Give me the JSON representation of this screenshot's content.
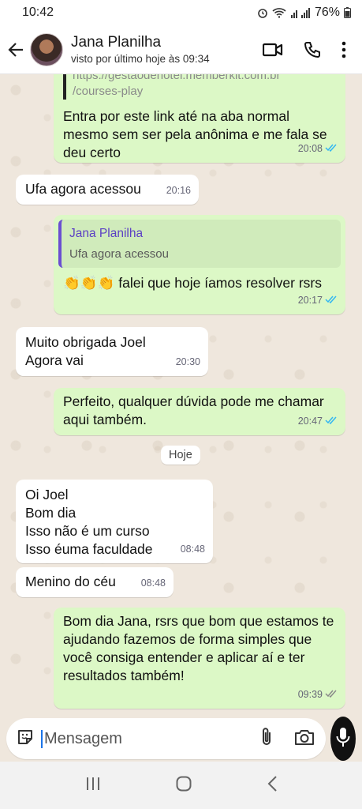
{
  "status_bar": {
    "time": "10:42",
    "battery": "76%"
  },
  "header": {
    "contact_name": "Jana Planilha",
    "contact_status": "visto por último hoje às 09:34"
  },
  "messages": [
    {
      "link_text": "https://gestaodehotel.memberkit.com.br\n/courses-play",
      "text": "Entra por este link até na aba normal mesmo sem ser pela anônima e me fala se deu certo",
      "time": "20:08"
    },
    {
      "text": "Ufa agora acessou",
      "time": "20:16"
    },
    {
      "quote_name": "Jana Planilha",
      "quote_text": "Ufa agora acessou",
      "text": "👏👏👏 falei que hoje íamos resolver rsrs",
      "time": "20:17"
    },
    {
      "text": "Muito obrigada Joel\nAgora vai",
      "time": "20:30"
    },
    {
      "text": "Perfeito, qualquer dúvida pode me chamar aqui também.",
      "time": "20:47"
    },
    {
      "text": "Oi Joel\nBom dia\nIsso não é um curso\nIsso éuma faculdade",
      "time": "08:48"
    },
    {
      "text": "Menino do céu",
      "time": "08:48"
    },
    {
      "text": "Bom dia Jana, rsrs que bom que estamos te ajudando fazemos de forma simples que você consiga entender e aplicar aí e ter resultados também!",
      "time": "09:39"
    }
  ],
  "day_badge": "Hoje",
  "composer": {
    "placeholder": "Mensagem"
  },
  "colors": {
    "outgoing_bubble": "#dcf8c6",
    "incoming_bubble": "#ffffff",
    "read_tick": "#34b7f1",
    "sent_tick": "#8a8a8a",
    "background": "#efe7dd"
  }
}
